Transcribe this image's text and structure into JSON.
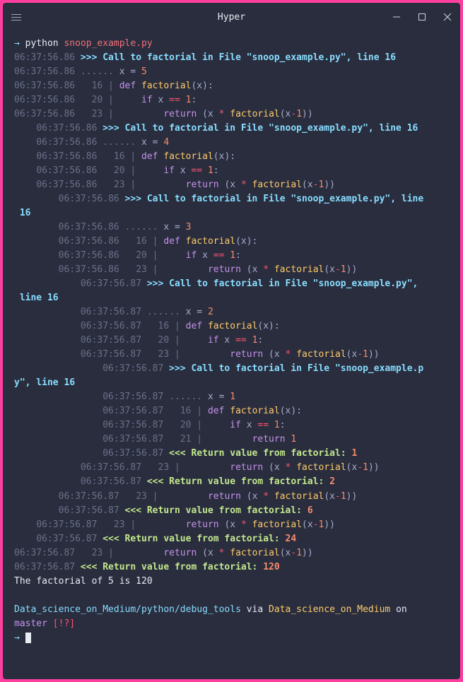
{
  "window": {
    "title": "Hyper"
  },
  "prompt1": {
    "arrow": "→",
    "cmd_prog": "python",
    "cmd_arg": "snoop_example.py"
  },
  "trace": {
    "ts1": "06:37:56.86",
    "ts2": "06:37:56.87",
    "file": "\"snoop_example.py\"",
    "call_prefix": ">>> Call to factorial in File ",
    "line_suffix": ", line 16",
    "dots": "......",
    "def_kw": "def",
    "fn": "factorial",
    "if_kw": "if",
    "eq": "==",
    "ret_kw": "return",
    "star": "*",
    "minus": "-",
    "one": "1",
    "ret_prefix": "<<< Return value from factorial: ",
    "ln16": "16",
    "ln20": "20",
    "ln21": "21",
    "ln23": "23",
    "x5": "5",
    "x4": "4",
    "x3": "3",
    "x2": "2",
    "x1": "1",
    "rv1": "1",
    "rv2": "2",
    "rv6": "6",
    "rv24": "24",
    "rv120": "120",
    "ind0": "",
    "ind1": "    ",
    "ind2": "        ",
    "ind3": "            ",
    "ind4": "                ",
    "pipe": " | ",
    "xvar": "x"
  },
  "result": "The factorial of 5 is 120",
  "prompt2": {
    "path": "Data_science_on_Medium/python/debug_tools",
    "via": "via",
    "env": "Data_science_on_Medium",
    "on": "on",
    "branch_icon": "",
    "branch": "master",
    "status": "[!?]",
    "arrow": "→"
  }
}
